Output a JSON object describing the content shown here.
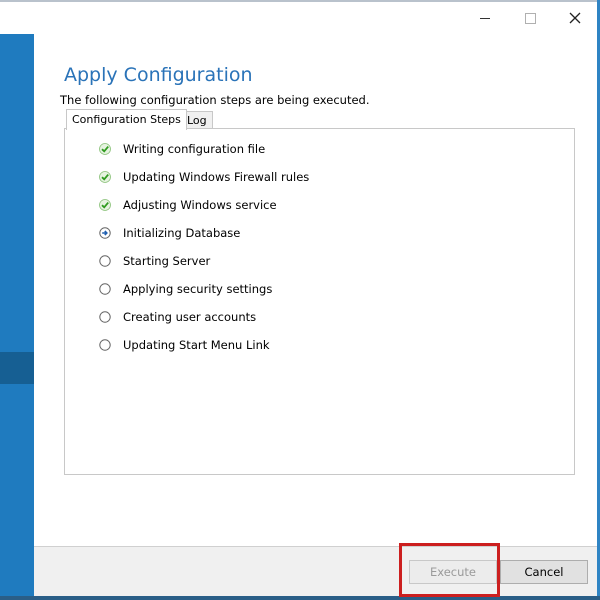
{
  "window": {
    "controls": {
      "minimize": "minimize",
      "maximize": "maximize",
      "close": "close"
    }
  },
  "header": {
    "title": "Apply Configuration",
    "subtitle": "The following configuration steps are being executed."
  },
  "tabs": [
    {
      "label": "Configuration Steps",
      "active": true
    },
    {
      "label": "Log",
      "active": false
    }
  ],
  "steps": [
    {
      "label": "Writing configuration file",
      "status": "done",
      "icon": "check-icon"
    },
    {
      "label": "Updating Windows Firewall rules",
      "status": "done",
      "icon": "check-icon"
    },
    {
      "label": "Adjusting Windows service",
      "status": "done",
      "icon": "check-icon"
    },
    {
      "label": "Initializing Database",
      "status": "in-progress",
      "icon": "arrow-circle-icon"
    },
    {
      "label": "Starting Server",
      "status": "pending",
      "icon": "empty-circle-icon"
    },
    {
      "label": "Applying security settings",
      "status": "pending",
      "icon": "empty-circle-icon"
    },
    {
      "label": "Creating user accounts",
      "status": "pending",
      "icon": "empty-circle-icon"
    },
    {
      "label": "Updating Start Menu Link",
      "status": "pending",
      "icon": "empty-circle-icon"
    }
  ],
  "buttons": {
    "execute": "Execute",
    "cancel": "Cancel"
  },
  "colors": {
    "accent": "#2a73b8",
    "sidebar": "#1f7bbf",
    "check": "#4caf32",
    "highlight": "#cc1f1f"
  }
}
